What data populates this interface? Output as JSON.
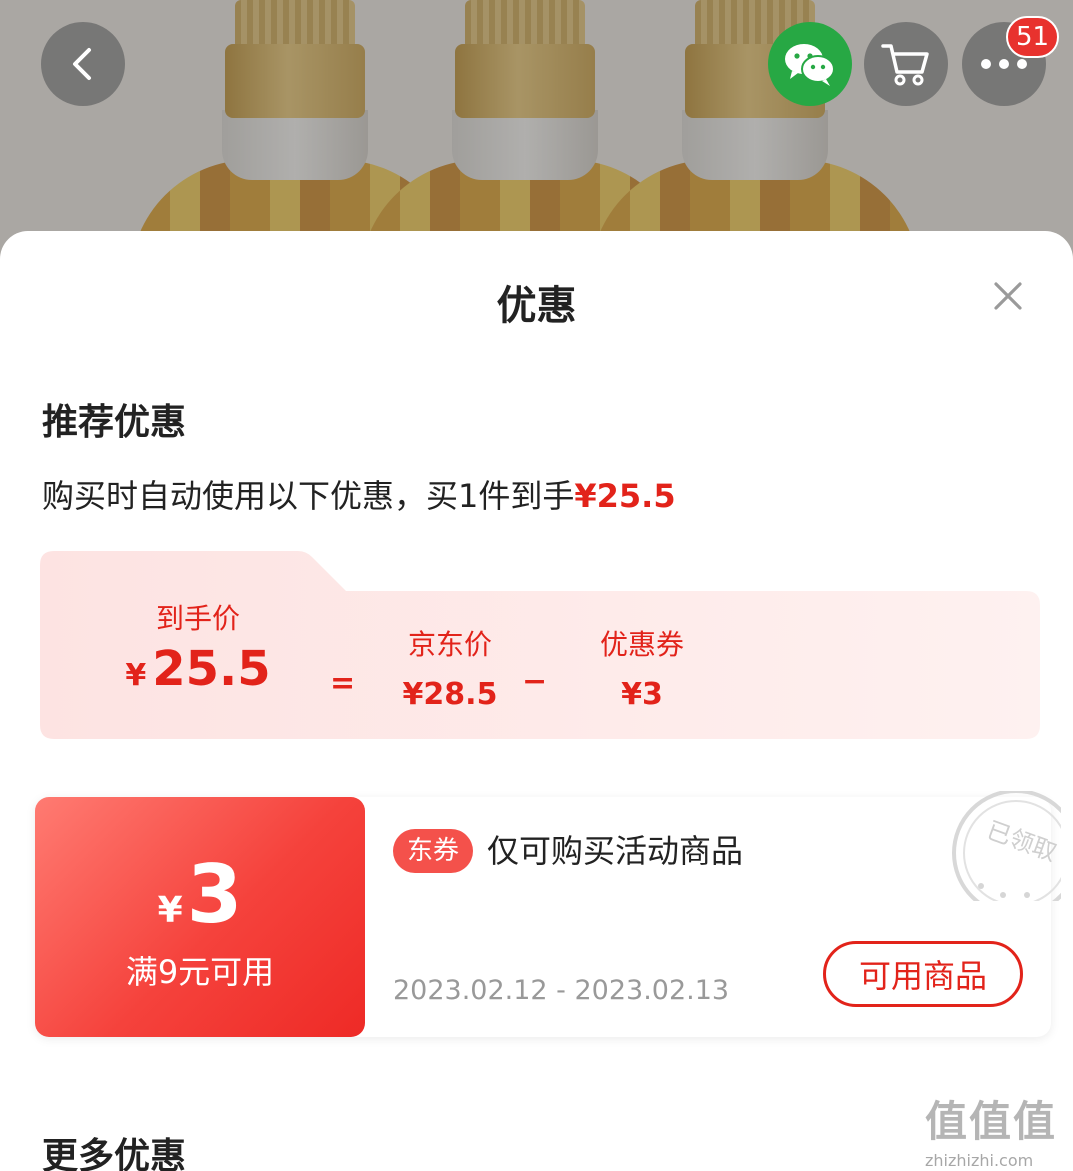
{
  "header": {
    "cart_badge_count": "51",
    "icons": {
      "back": "chevron-left-icon",
      "share": "wechat-icon",
      "cart": "cart-icon",
      "more": "more-dots-icon"
    }
  },
  "sheet": {
    "title": "优惠",
    "close_icon": "close-icon"
  },
  "recommended": {
    "section_title": "推荐优惠",
    "summary_prefix": "购买时自动使用以下优惠，买1件到手",
    "summary_price": "¥25.5",
    "breakdown": {
      "final_label": "到手价",
      "final_currency": "¥",
      "final_value": "25.5",
      "equals": "=",
      "jd_price_label": "京东价",
      "jd_price_value": "¥28.5",
      "minus": "−",
      "coupon_label": "优惠券",
      "coupon_value": "¥3"
    }
  },
  "coupon": {
    "currency": "¥",
    "amount": "3",
    "condition": "满9元可用",
    "tag": "东券",
    "description": "仅可购买活动商品",
    "date_range": "2023.02.12 - 2023.02.13",
    "button_label": "可用商品",
    "stamp_text": "已领取"
  },
  "more": {
    "section_title": "更多优惠"
  },
  "watermark": {
    "logo": "值值值",
    "url": "zhizhizhi.com"
  },
  "colors": {
    "accent_red": "#e2231a",
    "coupon_gradient_start": "#ff7b72",
    "coupon_gradient_end": "#ee2a26",
    "wechat_green": "#27a844",
    "breakdown_bg": "#fdeceb"
  }
}
